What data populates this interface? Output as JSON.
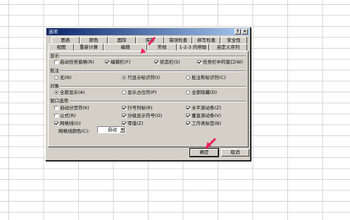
{
  "dialog": {
    "title": "选项",
    "help_glyph": "?",
    "close_glyph": "×"
  },
  "tabs_row1": [
    "图表",
    "颜色",
    "国际",
    "保存",
    "错误检查",
    "拼写检查",
    "安全性"
  ],
  "tabs_row2": [
    "视图",
    "重新计算",
    "编辑",
    "常规",
    "1-2-3 的帮助",
    "自定义序列"
  ],
  "show": {
    "label": "显示",
    "startup_pane": {
      "label": "启动任务窗格(R)",
      "checked": false
    },
    "formula_bar": {
      "label": "编辑栏(F)",
      "checked": true
    },
    "status_bar": {
      "label": "状态栏(S)",
      "checked": true
    },
    "windows_in_taskbar": {
      "label": "任务栏中的窗口(W)",
      "checked": true
    }
  },
  "comments": {
    "label": "批注",
    "none": {
      "label": "无(N)",
      "selected": false
    },
    "indicator_only": {
      "label": "只显示标识符(I)",
      "selected": true
    },
    "indicator_and_comment": {
      "label": "批注和标识符(C)",
      "selected": false
    }
  },
  "objects": {
    "label": "对象",
    "show_all": {
      "label": "全部显示(A)",
      "selected": true
    },
    "show_placeholders": {
      "label": "显示占位符(P)",
      "selected": false
    },
    "hide_all": {
      "label": "全部隐藏(D)",
      "selected": false
    }
  },
  "window_options": {
    "label": "窗口选项",
    "page_breaks": {
      "label": "自动分页符(K)",
      "checked": false
    },
    "row_col_headers": {
      "label": "行号列标(R)",
      "checked": true
    },
    "horizontal_scroll": {
      "label": "水平滚动条(Z)",
      "checked": true
    },
    "formulas": {
      "label": "公式(R)",
      "checked": false
    },
    "outline_symbols": {
      "label": "分级显示符号(O)",
      "checked": true
    },
    "vertical_scroll": {
      "label": "垂直滚动条(V)",
      "checked": true
    },
    "gridlines": {
      "label": "网格线(G)",
      "checked": true
    },
    "zero_values": {
      "label": "零值(Z)",
      "checked": true
    },
    "sheet_tabs": {
      "label": "工作表标签(B)",
      "checked": true
    },
    "gridline_color_label": "网格线颜色(C):",
    "gridline_color_value": "自动"
  },
  "buttons": {
    "ok": "确定",
    "cancel": "取消"
  },
  "colors": {
    "annotation_arrow": "#ee1c5e",
    "titlebar": "#0a246a",
    "dialog_bg": "#d4d0c8"
  }
}
